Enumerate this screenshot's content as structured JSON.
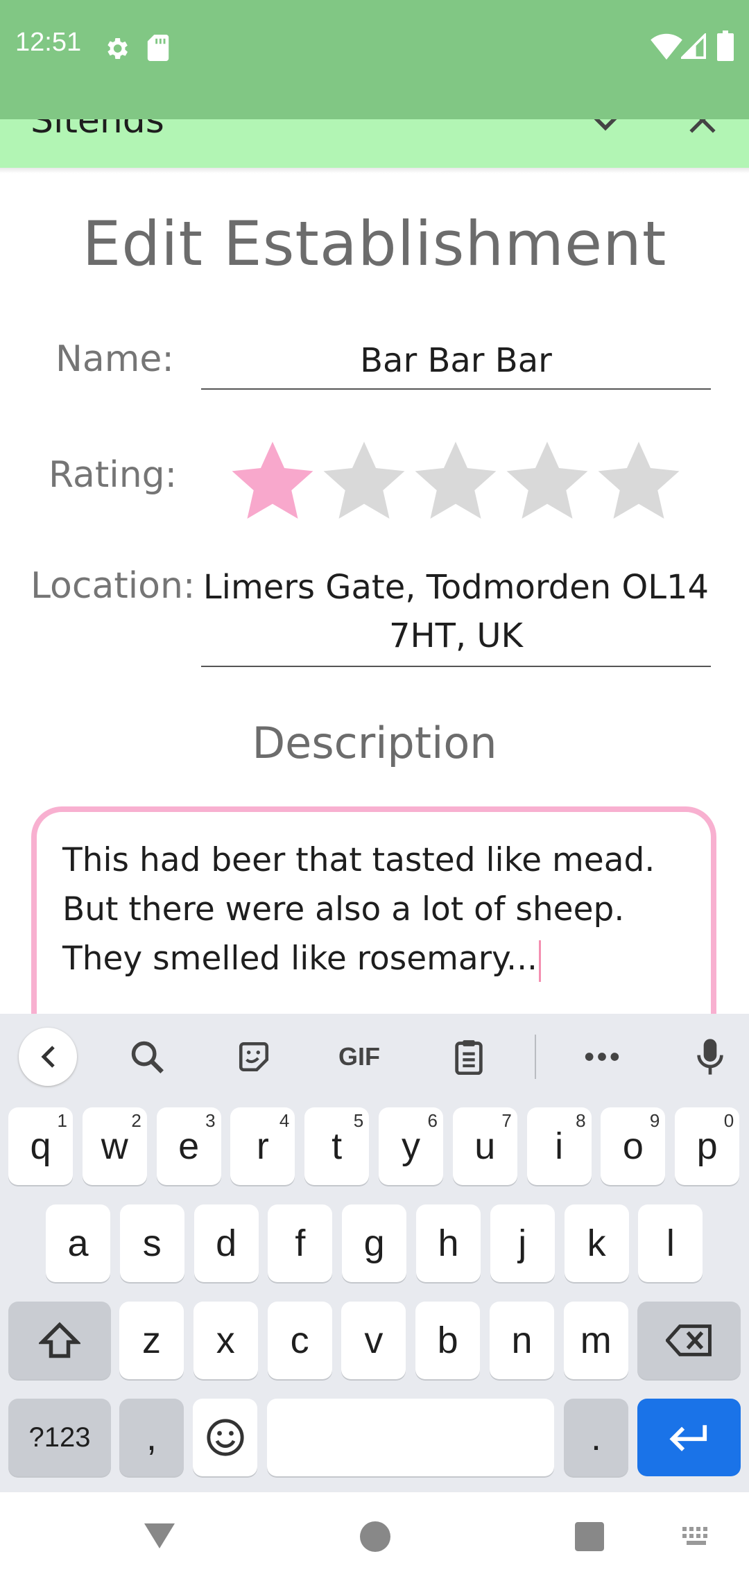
{
  "status_bar": {
    "time": "12:51",
    "icons": [
      "settings-icon",
      "sd-card-icon",
      "wifi-icon",
      "signal-icon",
      "battery-icon"
    ]
  },
  "app_bar": {
    "title": "Sitends",
    "icons": [
      "chevron-down-icon",
      "close-icon"
    ]
  },
  "page": {
    "title": "Edit Establishment",
    "name_label": "Name:",
    "name_value": "Bar Bar Bar",
    "rating_label": "Rating:",
    "rating": 1,
    "rating_max": 5,
    "location_label": "Location:",
    "location_line1": "Limers Gate, Todmorden OL14",
    "location_line2": "7HT, UK",
    "description_heading": "Description",
    "description_lines": [
      "This had beer that tasted like mead.",
      "But there were also a lot of sheep.",
      "They smelled like rosemary..."
    ]
  },
  "colors": {
    "status_bar": "#81c784",
    "app_bar": "#b2f5b4",
    "accent_pink": "#f8a8cc",
    "star_off": "#d9d9d9",
    "enter_key": "#1a73e8"
  },
  "keyboard": {
    "toolbar": [
      "back-icon",
      "search-icon",
      "sticker-icon",
      "gif-icon",
      "clipboard-icon",
      "more-icon",
      "mic-icon"
    ],
    "gif_label": "GIF",
    "row1": [
      {
        "k": "q",
        "h": "1"
      },
      {
        "k": "w",
        "h": "2"
      },
      {
        "k": "e",
        "h": "3"
      },
      {
        "k": "r",
        "h": "4"
      },
      {
        "k": "t",
        "h": "5"
      },
      {
        "k": "y",
        "h": "6"
      },
      {
        "k": "u",
        "h": "7"
      },
      {
        "k": "i",
        "h": "8"
      },
      {
        "k": "o",
        "h": "9"
      },
      {
        "k": "p",
        "h": "0"
      }
    ],
    "row2": [
      "a",
      "s",
      "d",
      "f",
      "g",
      "h",
      "j",
      "k",
      "l"
    ],
    "row3": [
      "z",
      "x",
      "c",
      "v",
      "b",
      "n",
      "m"
    ],
    "symbols_label": "?123",
    "comma": ",",
    "period": "."
  },
  "nav_bar": {
    "icons": [
      "back-triangle-icon",
      "home-circle-icon",
      "recents-square-icon",
      "keyboard-switch-icon"
    ]
  }
}
